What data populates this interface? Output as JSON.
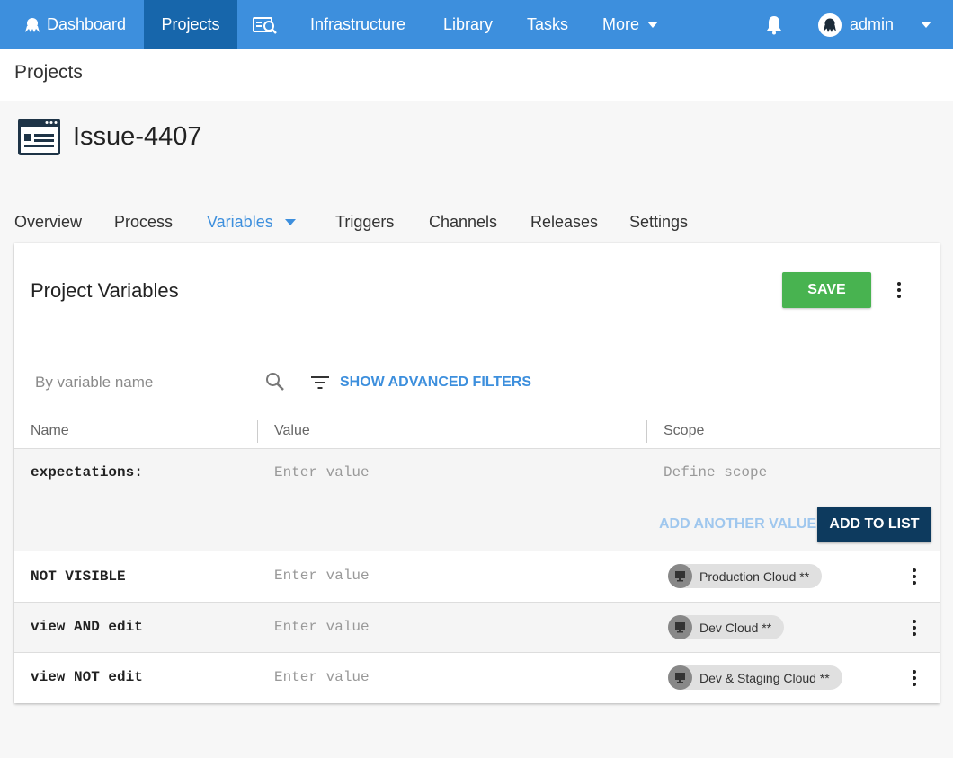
{
  "nav": {
    "dashboard": "Dashboard",
    "projects": "Projects",
    "infrastructure": "Infrastructure",
    "library": "Library",
    "tasks": "Tasks",
    "more": "More",
    "user": "admin"
  },
  "breadcrumb": "Projects",
  "project": {
    "title": "Issue-4407"
  },
  "tabs": {
    "overview": "Overview",
    "process": "Process",
    "variables": "Variables",
    "triggers": "Triggers",
    "channels": "Channels",
    "releases": "Releases",
    "settings": "Settings"
  },
  "card": {
    "title": "Project Variables",
    "save_label": "SAVE",
    "search_placeholder": "By variable name",
    "advanced_filters_label": "SHOW ADVANCED FILTERS",
    "columns": {
      "name": "Name",
      "value": "Value",
      "scope": "Scope"
    },
    "editing_row": {
      "name": "expectations:",
      "value_placeholder": "Enter value",
      "scope_placeholder": "Define scope"
    },
    "add_another_label": "ADD ANOTHER VALUE",
    "add_to_list_label": "ADD TO LIST",
    "rows": [
      {
        "name": "NOT VISIBLE",
        "value_placeholder": "Enter value",
        "scope": "Production Cloud **"
      },
      {
        "name": "view AND edit",
        "value_placeholder": "Enter value",
        "scope": "Dev Cloud **"
      },
      {
        "name": "view NOT edit",
        "value_placeholder": "Enter value",
        "scope": "Dev & Staging Cloud **"
      }
    ]
  },
  "colors": {
    "nav_bg": "#3d8fdd",
    "nav_active": "#1766ab",
    "save_green": "#48b350",
    "add_to_list_navy": "#0d3a5e",
    "link_blue": "#3d8fdd"
  },
  "icons": {
    "dashboard": "octopus-icon",
    "search_nav": "search-task-icon",
    "notifications": "bell-icon",
    "avatar": "octopus-avatar-icon",
    "project": "project-window-icon",
    "search": "search-icon",
    "filter": "filter-icon",
    "scope_chip": "machine-icon"
  }
}
